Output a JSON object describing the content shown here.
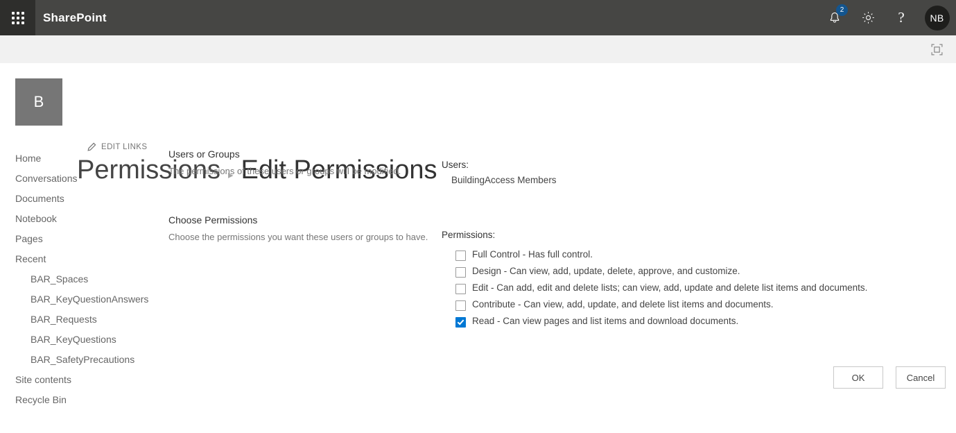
{
  "suite_bar": {
    "app_launcher_label": "app-launcher",
    "brand": "SharePoint",
    "notification_count": "2",
    "help_glyph": "?",
    "avatar_initials": "NB",
    "colors": {
      "bar_bg": "#464644",
      "waffle_bg": "#2e2e2c",
      "badge_bg": "#13558f"
    }
  },
  "sub_bar": {
    "focus_label": "Focus on content"
  },
  "site_header": {
    "logo_initial": "B",
    "edit_links_label": "EDIT LINKS",
    "breadcrumb_parent": "Permissions",
    "breadcrumb_separator": "▸",
    "breadcrumb_current": "Edit Permissions"
  },
  "left_nav": {
    "items": [
      {
        "label": "Home",
        "child": false
      },
      {
        "label": "Conversations",
        "child": false
      },
      {
        "label": "Documents",
        "child": false
      },
      {
        "label": "Notebook",
        "child": false
      },
      {
        "label": "Pages",
        "child": false
      },
      {
        "label": "Recent",
        "child": false
      },
      {
        "label": "BAR_Spaces",
        "child": true
      },
      {
        "label": "BAR_KeyQuestionAnswers",
        "child": true
      },
      {
        "label": "BAR_Requests",
        "child": true
      },
      {
        "label": "BAR_KeyQuestions",
        "child": true
      },
      {
        "label": "BAR_SafetyPrecautions",
        "child": true
      },
      {
        "label": "Site contents",
        "child": false
      },
      {
        "label": "Recycle Bin",
        "child": false
      }
    ]
  },
  "descriptions": {
    "users_heading": "Users or Groups",
    "users_desc": "The permissions of these users or groups will be modified.",
    "choose_heading": "Choose Permissions",
    "choose_desc": "Choose the permissions you want these users or groups to have."
  },
  "form": {
    "users_label": "Users:",
    "users_value": "BuildingAccess Members",
    "permissions_label": "Permissions:",
    "permissions": [
      {
        "label": "Full Control - Has full control.",
        "checked": false
      },
      {
        "label": "Design - Can view, add, update, delete, approve, and customize.",
        "checked": false
      },
      {
        "label": "Edit - Can add, edit and delete lists; can view, add, update and delete list items and documents.",
        "checked": false
      },
      {
        "label": "Contribute - Can view, add, update, and delete list items and documents.",
        "checked": false
      },
      {
        "label": "Read - Can view pages and list items and download documents.",
        "checked": true
      }
    ],
    "accent_color": "#0078d4"
  },
  "buttons": {
    "ok": "OK",
    "cancel": "Cancel"
  }
}
